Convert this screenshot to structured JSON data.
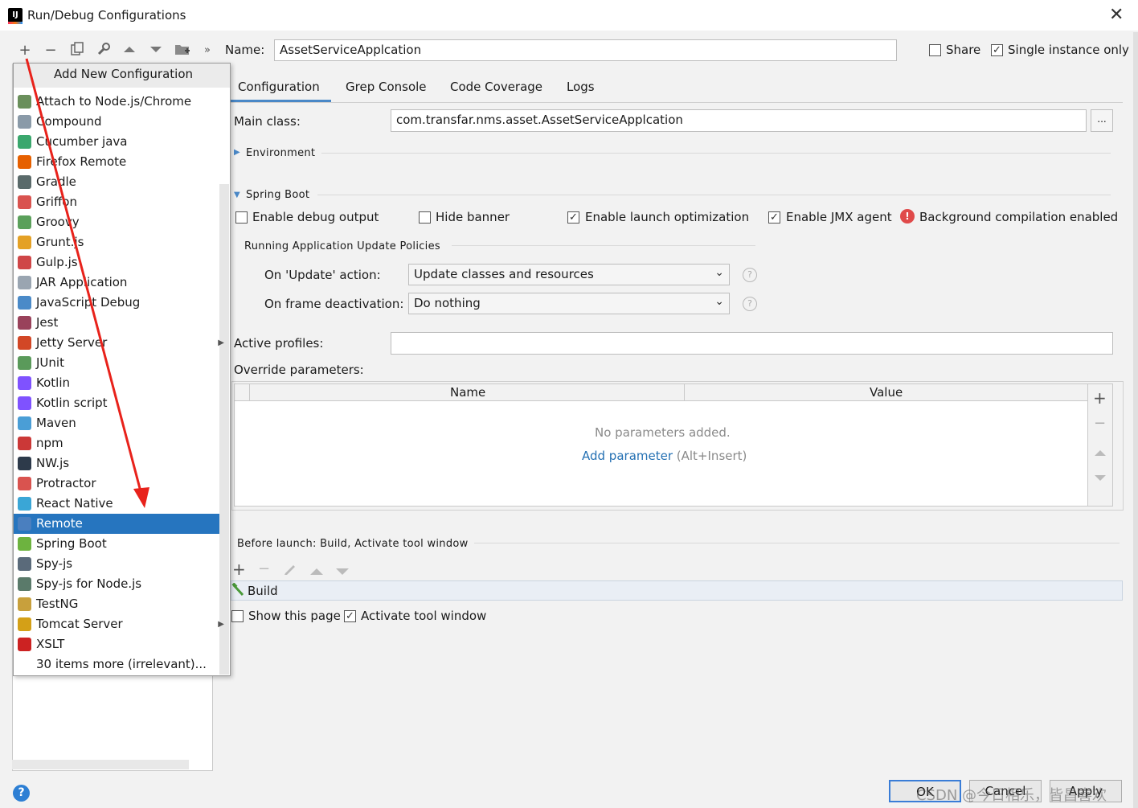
{
  "window": {
    "title": "Run/Debug Configurations",
    "close_glyph": "✕"
  },
  "toolbar": {
    "icons": [
      "plus-icon",
      "minus-icon",
      "copy-icon",
      "wrench-icon",
      "up-icon",
      "down-icon",
      "folder-icon",
      "more-icon"
    ],
    "name_label": "Name:",
    "name_value": "AssetServiceApplcation",
    "share_label": "Share",
    "share_checked": false,
    "single_instance_label": "Single instance only",
    "single_instance_checked": true
  },
  "popup": {
    "header": "Add New Configuration",
    "items": [
      {
        "label": "Attach to Node.js/Chrome",
        "icon": "attach-icon",
        "color": "#6a8f5b"
      },
      {
        "label": "Compound",
        "icon": "compound-icon",
        "color": "#8a9aa8"
      },
      {
        "label": "Cucumber java",
        "icon": "cucumber-icon",
        "color": "#3aa76d"
      },
      {
        "label": "Firefox Remote",
        "icon": "firefox-icon",
        "color": "#e66000"
      },
      {
        "label": "Gradle",
        "icon": "gradle-icon",
        "color": "#5a6a6a"
      },
      {
        "label": "Griffon",
        "icon": "griffon-icon",
        "color": "#d9534f"
      },
      {
        "label": "Groovy",
        "icon": "groovy-icon",
        "color": "#5ba05b"
      },
      {
        "label": "Grunt.js",
        "icon": "grunt-icon",
        "color": "#e4a125"
      },
      {
        "label": "Gulp.js",
        "icon": "gulp-icon",
        "color": "#cf4647"
      },
      {
        "label": "JAR Application",
        "icon": "jar-icon",
        "color": "#9aa5b1"
      },
      {
        "label": "JavaScript Debug",
        "icon": "js-debug-icon",
        "color": "#4a8ac8"
      },
      {
        "label": "Jest",
        "icon": "jest-icon",
        "color": "#99425b"
      },
      {
        "label": "Jetty Server",
        "icon": "jetty-icon",
        "color": "#d24726",
        "submenu": true
      },
      {
        "label": "JUnit",
        "icon": "junit-icon",
        "color": "#5a9a5a"
      },
      {
        "label": "Kotlin",
        "icon": "kotlin-icon",
        "color": "#7f52ff"
      },
      {
        "label": "Kotlin script",
        "icon": "kotlin-script-icon",
        "color": "#7f52ff"
      },
      {
        "label": "Maven",
        "icon": "maven-icon",
        "color": "#4a9ed6"
      },
      {
        "label": "npm",
        "icon": "npm-icon",
        "color": "#cb3837"
      },
      {
        "label": "NW.js",
        "icon": "nwjs-icon",
        "color": "#2d3a4a"
      },
      {
        "label": "Protractor",
        "icon": "protractor-icon",
        "color": "#d9534f"
      },
      {
        "label": "React Native",
        "icon": "react-icon",
        "color": "#3aa6d6"
      },
      {
        "label": "Remote",
        "icon": "remote-icon",
        "color": "#4a7fbf",
        "selected": true
      },
      {
        "label": "Spring Boot",
        "icon": "spring-boot-icon",
        "color": "#6db33f"
      },
      {
        "label": "Spy-js",
        "icon": "spy-js-icon",
        "color": "#5a6a7a"
      },
      {
        "label": "Spy-js for Node.js",
        "icon": "spy-js-node-icon",
        "color": "#5a7a6a"
      },
      {
        "label": "TestNG",
        "icon": "testng-icon",
        "color": "#c8a03c"
      },
      {
        "label": "Tomcat Server",
        "icon": "tomcat-icon",
        "color": "#d4a017",
        "submenu": true
      },
      {
        "label": "XSLT",
        "icon": "xslt-icon",
        "color": "#cc2222"
      },
      {
        "label": "30 items more (irrelevant)...",
        "icon": "",
        "color": ""
      }
    ]
  },
  "tabs": [
    {
      "label": "Configuration",
      "active": true
    },
    {
      "label": "Grep Console"
    },
    {
      "label": "Code Coverage"
    },
    {
      "label": "Logs"
    }
  ],
  "config": {
    "main_class_label": "Main class:",
    "main_class_value": "com.transfar.nms.asset.AssetServiceApplcation",
    "browse_label": "...",
    "environment_label": "Environment",
    "spring_boot_label": "Spring Boot",
    "enable_debug_label": "Enable debug output",
    "enable_debug_checked": false,
    "hide_banner_label": "Hide banner",
    "hide_banner_checked": false,
    "launch_opt_label": "Enable launch optimization",
    "launch_opt_checked": true,
    "jmx_label": "Enable JMX agent",
    "jmx_checked": true,
    "bg_compile_label": "Background compilation enabled",
    "policies_label": "Running Application Update Policies",
    "on_update_label": "On 'Update' action:",
    "on_update_value": "Update classes and resources",
    "on_frame_label": "On frame deactivation:",
    "on_frame_value": "Do nothing",
    "active_profiles_label": "Active profiles:",
    "active_profiles_value": "",
    "override_label": "Override parameters:",
    "table_col_name": "Name",
    "table_col_value": "Value",
    "no_params": "No parameters added.",
    "add_param_link": "Add parameter",
    "add_param_hint": "(Alt+Insert)"
  },
  "before_launch": {
    "label": "Before launch: Build, Activate tool window",
    "build_item": "Build",
    "show_page_label": "Show this page",
    "show_page_checked": false,
    "activate_label": "Activate tool window",
    "activate_checked": true
  },
  "buttons": {
    "ok": "OK",
    "cancel": "Cancel",
    "apply": "Apply"
  },
  "help_glyph": "?",
  "watermark": "CSDN @今日相乐，皆昌喜欢",
  "annotation_arrow_color": "#e8221b"
}
